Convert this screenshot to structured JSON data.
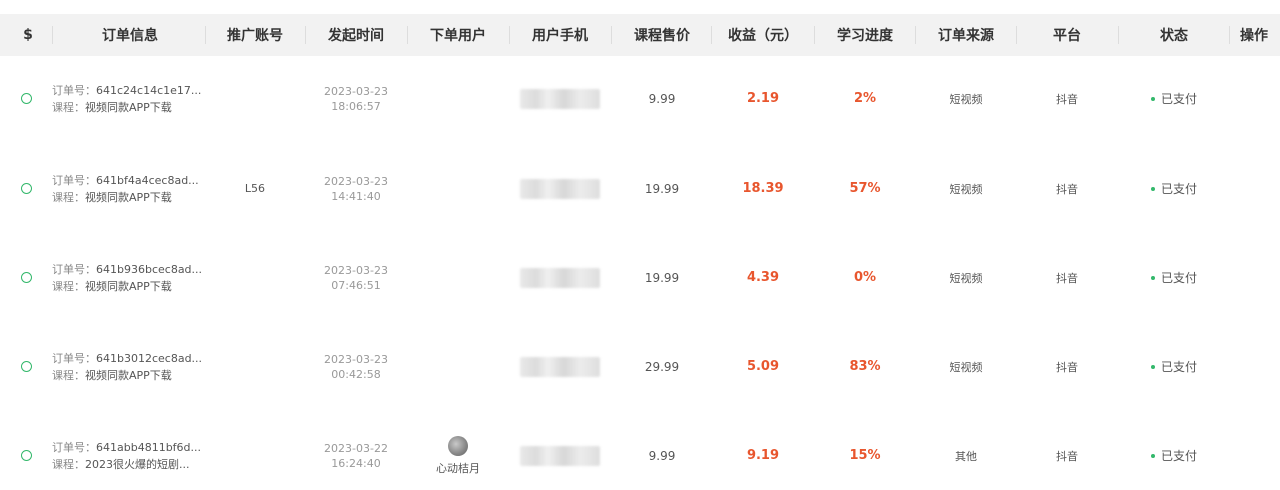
{
  "columns": {
    "dollar": "$",
    "order_info": "订单信息",
    "promo_account": "推广账号",
    "start_time": "发起时间",
    "order_user": "下单用户",
    "user_phone": "用户手机",
    "course_price": "课程售价",
    "earnings": "收益（元）",
    "progress": "学习进度",
    "order_source": "订单来源",
    "platform": "平台",
    "status": "状态",
    "actions": "操作"
  },
  "labels": {
    "order_no_prefix": "订单号：",
    "course_prefix": "课程："
  },
  "rows": [
    {
      "order_no": "641c24c14c1e17...",
      "course": "视频同款APP下载",
      "account": "",
      "date": "2023-03-23",
      "time": "18:06:57",
      "user": "",
      "price": "9.99",
      "earnings": "2.19",
      "progress": "2%",
      "source": "短视频",
      "platform": "抖音",
      "status": "已支付"
    },
    {
      "order_no": "641bf4a4cec8ad...",
      "course": "视频同款APP下载",
      "account": "L56",
      "date": "2023-03-23",
      "time": "14:41:40",
      "user": "",
      "price": "19.99",
      "earnings": "18.39",
      "progress": "57%",
      "source": "短视频",
      "platform": "抖音",
      "status": "已支付"
    },
    {
      "order_no": "641b936bcec8ad...",
      "course": "视频同款APP下载",
      "account": "",
      "date": "2023-03-23",
      "time": "07:46:51",
      "user": "",
      "price": "19.99",
      "earnings": "4.39",
      "progress": "0%",
      "source": "短视频",
      "platform": "抖音",
      "status": "已支付"
    },
    {
      "order_no": "641b3012cec8ad...",
      "course": "视频同款APP下载",
      "account": "",
      "date": "2023-03-23",
      "time": "00:42:58",
      "user": "",
      "price": "29.99",
      "earnings": "5.09",
      "progress": "83%",
      "source": "短视频",
      "platform": "抖音",
      "status": "已支付"
    },
    {
      "order_no": "641abb4811bf6d...",
      "course": "2023很火爆的短剧...",
      "account": "",
      "date": "2023-03-22",
      "time": "16:24:40",
      "user": "心动桔月",
      "price": "9.99",
      "earnings": "9.19",
      "progress": "15%",
      "source": "其他",
      "platform": "抖音",
      "status": "已支付"
    }
  ],
  "colors": {
    "accent_green": "#33b86b",
    "earnings_red": "#e8562e",
    "header_bg": "#f2f2f2"
  }
}
